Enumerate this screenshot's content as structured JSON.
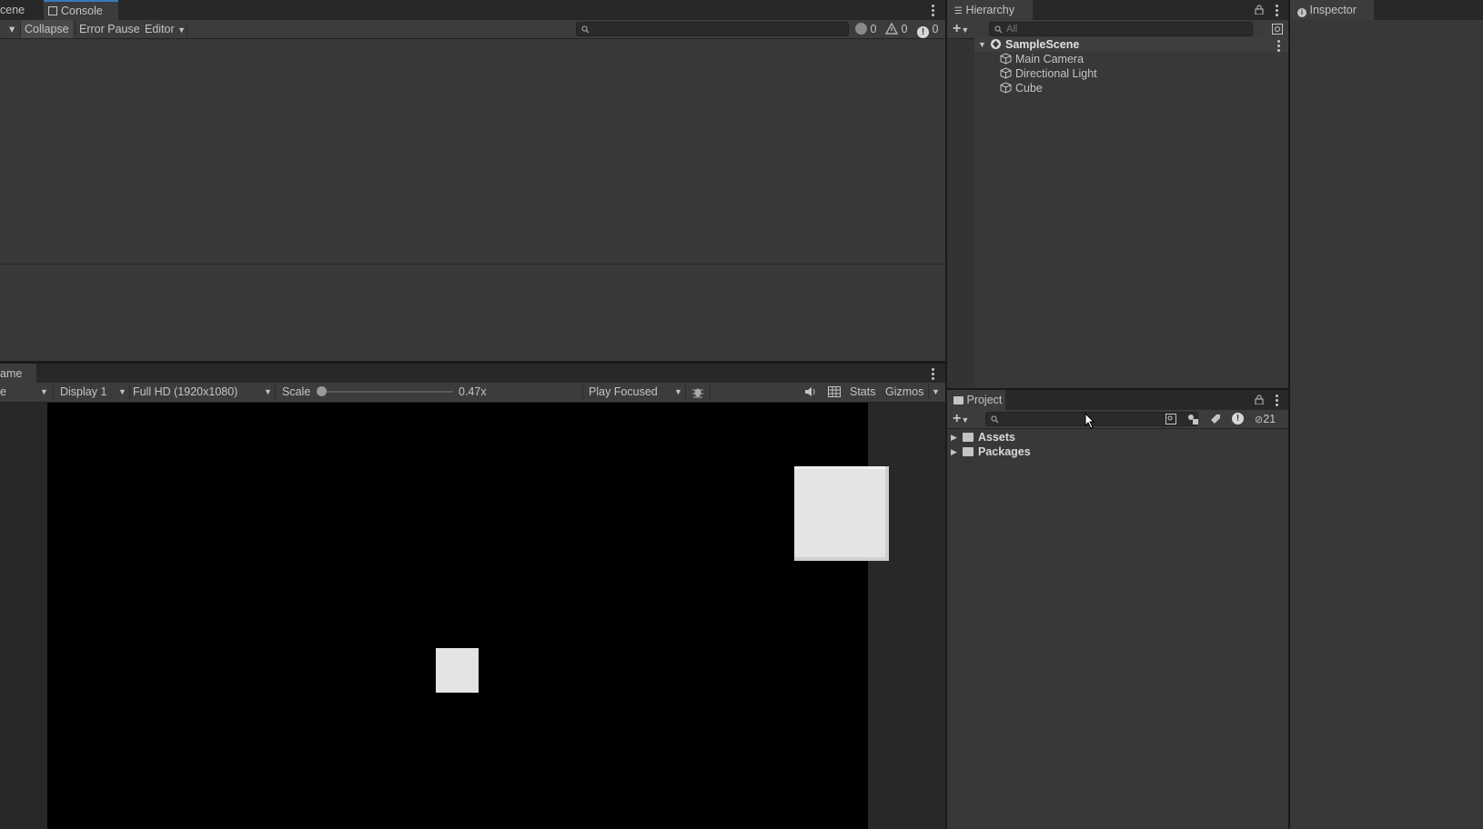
{
  "console_panel": {
    "tabs": [
      {
        "label": "cene",
        "icon": "scene-icon"
      },
      {
        "label": "Console",
        "icon": "console-icon"
      }
    ],
    "toolbar": {
      "collapse_label": "Collapse",
      "error_pause_label": "Error Pause",
      "editor_label": "Editor",
      "search_value": "",
      "log_count": "0",
      "warning_count": "0",
      "error_count": "0"
    }
  },
  "game_panel": {
    "tab_label": "ame",
    "toolbar": {
      "game_dropdown": "e",
      "display": "Display 1",
      "resolution": "Full HD (1920x1080)",
      "scale_label": "Scale",
      "scale_value": "0.47x",
      "scale_fraction": 0.0,
      "play_mode": "Play Focused",
      "stats_label": "Stats",
      "gizmos_label": "Gizmos"
    }
  },
  "hierarchy_panel": {
    "tab_label": "Hierarchy",
    "search_placeholder": "All",
    "scene_name": "SampleScene",
    "items": [
      {
        "label": "Main Camera",
        "icon": "gameobject-icon"
      },
      {
        "label": "Directional Light",
        "icon": "gameobject-icon"
      },
      {
        "label": "Cube",
        "icon": "gameobject-icon"
      }
    ]
  },
  "project_panel": {
    "tab_label": "Project",
    "search_value": "",
    "hidden_count": "21",
    "folders": [
      {
        "label": "Assets",
        "icon": "folder-icon"
      },
      {
        "label": "Packages",
        "icon": "folder-icon"
      }
    ]
  },
  "inspector_panel": {
    "tab_label": "Inspector"
  },
  "colors": {
    "panel_bg": "#383838",
    "tab_bar_bg": "#282828",
    "accent": "#3a79bb",
    "game_view_bg": "#000000",
    "cube_color": "#e6e6e6"
  }
}
